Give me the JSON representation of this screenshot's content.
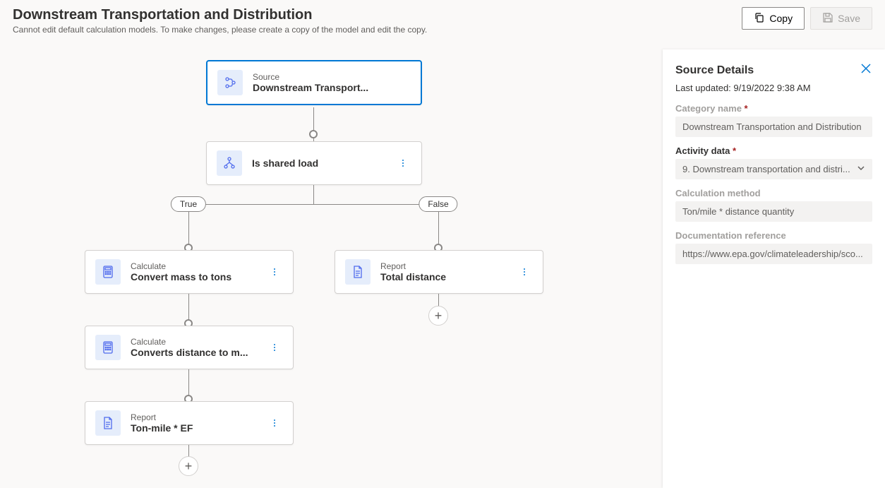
{
  "header": {
    "title": "Downstream Transportation and Distribution",
    "subtitle": "Cannot edit default calculation models. To make changes, please create a copy of the model and edit the copy.",
    "copy_label": "Copy",
    "save_label": "Save"
  },
  "nodes": {
    "source": {
      "type": "Source",
      "title": "Downstream Transport..."
    },
    "condition": {
      "title": "Is shared load"
    },
    "true_label": "True",
    "false_label": "False",
    "calc1": {
      "type": "Calculate",
      "title": "Convert mass to tons"
    },
    "calc2": {
      "type": "Calculate",
      "title": "Converts distance to m..."
    },
    "report_left": {
      "type": "Report",
      "title": "Ton-mile * EF"
    },
    "report_right": {
      "type": "Report",
      "title": "Total distance"
    }
  },
  "panel": {
    "title": "Source Details",
    "updated": "Last updated: 9/19/2022 9:38 AM",
    "fields": {
      "category_label": "Category name",
      "category_value": "Downstream Transportation and Distribution",
      "activity_label": "Activity data",
      "activity_value": "9. Downstream transportation and distri...",
      "method_label": "Calculation method",
      "method_value": "Ton/mile * distance quantity",
      "doc_label": "Documentation reference",
      "doc_value": "https://www.epa.gov/climateleadership/sco..."
    }
  }
}
